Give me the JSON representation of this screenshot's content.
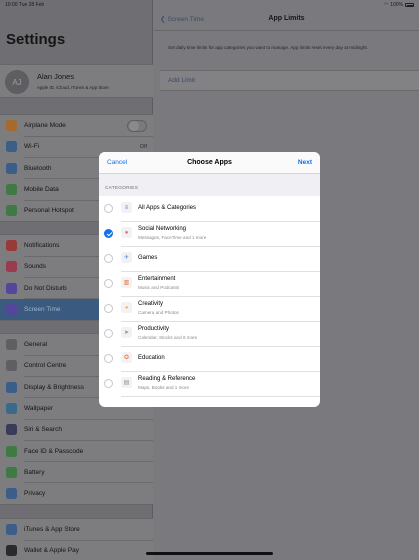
{
  "status": {
    "time": "10:00",
    "date": "Tue 28 Feb",
    "battery": "100%"
  },
  "sidebar": {
    "title": "Settings",
    "account": {
      "initials": "AJ",
      "name": "Alan Jones",
      "subtitle": "Apple ID, iCloud, iTunes & App Store"
    },
    "group1": [
      {
        "label": "Airplane Mode",
        "icon": "airplane-icon",
        "color": "#a66a2c"
      },
      {
        "label": "Wi-Fi",
        "value": "Off",
        "icon": "wifi-icon",
        "color": "#3a5e87"
      },
      {
        "label": "Bluetooth",
        "icon": "bluetooth-icon",
        "color": "#3a5e87"
      },
      {
        "label": "Mobile Data",
        "icon": "antenna-icon",
        "color": "#3f7a45"
      },
      {
        "label": "Personal Hotspot",
        "icon": "link-icon",
        "color": "#3f7a45"
      }
    ],
    "group2": [
      {
        "label": "Notifications",
        "icon": "notifications-icon",
        "color": "#9a3a38"
      },
      {
        "label": "Sounds",
        "icon": "speaker-icon",
        "color": "#9a3a4e"
      },
      {
        "label": "Do Not Disturb",
        "icon": "moon-icon",
        "color": "#54469a"
      },
      {
        "label": "Screen Time",
        "icon": "hourglass-icon",
        "color": "#54469a"
      }
    ],
    "group3": [
      {
        "label": "General",
        "icon": "gear-icon",
        "color": "#5f5f63"
      },
      {
        "label": "Control Centre",
        "icon": "sliders-icon",
        "color": "#5f5f63"
      },
      {
        "label": "Display & Brightness",
        "icon": "text-size-icon",
        "color": "#3a5e87"
      },
      {
        "label": "Wallpaper",
        "icon": "flower-icon",
        "color": "#3a6a8a"
      },
      {
        "label": "Siri & Search",
        "icon": "siri-icon",
        "color": "#3a3a5a"
      },
      {
        "label": "Face ID & Passcode",
        "icon": "face-id-icon",
        "color": "#3f7a45"
      },
      {
        "label": "Battery",
        "icon": "battery-icon",
        "color": "#3f7a45"
      },
      {
        "label": "Privacy",
        "icon": "hand-icon",
        "color": "#3a5e87"
      }
    ],
    "group4": [
      {
        "label": "iTunes & App Store",
        "icon": "app-store-icon",
        "color": "#3a5e87"
      },
      {
        "label": "Wallet & Apple Pay",
        "icon": "wallet-icon",
        "color": "#2a2a2a"
      }
    ]
  },
  "detail": {
    "back_label": "Screen Time",
    "title": "App Limits",
    "description": "Set daily time limits for app categories you want to manage. App limits reset every day at midnight.",
    "add_limit": "Add Limit"
  },
  "modal": {
    "cancel": "Cancel",
    "title": "Choose Apps",
    "next": "Next",
    "section": "CATEGORIES",
    "items": [
      {
        "name": "All Apps & Categories",
        "sub": "",
        "checked": false,
        "icon": "layers-icon",
        "color": "#4a7dd8",
        "glyph": "≡"
      },
      {
        "name": "Social Networking",
        "sub": "Messages, FaceTime and 1 more",
        "checked": true,
        "icon": "speech-bubble-icon",
        "color": "#e8607a",
        "glyph": "●"
      },
      {
        "name": "Games",
        "sub": "",
        "checked": false,
        "icon": "rocket-icon",
        "color": "#5b86e5",
        "glyph": "✈"
      },
      {
        "name": "Entertainment",
        "sub": "Music and Podcasts",
        "checked": false,
        "icon": "popcorn-icon",
        "color": "#e8663a",
        "glyph": "▥"
      },
      {
        "name": "Creativity",
        "sub": "Camera and Photos",
        "checked": false,
        "icon": "palette-icon",
        "color": "#e8a93a",
        "glyph": "◕"
      },
      {
        "name": "Productivity",
        "sub": "Calendar, Stocks and 6 more",
        "checked": false,
        "icon": "paper-plane-icon",
        "color": "#8e8e93",
        "glyph": "➤"
      },
      {
        "name": "Education",
        "sub": "",
        "checked": false,
        "icon": "globe-icon",
        "color": "#f0803a",
        "glyph": "✪"
      },
      {
        "name": "Reading & Reference",
        "sub": "Maps, Books and 1 more",
        "checked": false,
        "icon": "book-icon",
        "color": "#8e8e93",
        "glyph": "▤"
      }
    ]
  }
}
